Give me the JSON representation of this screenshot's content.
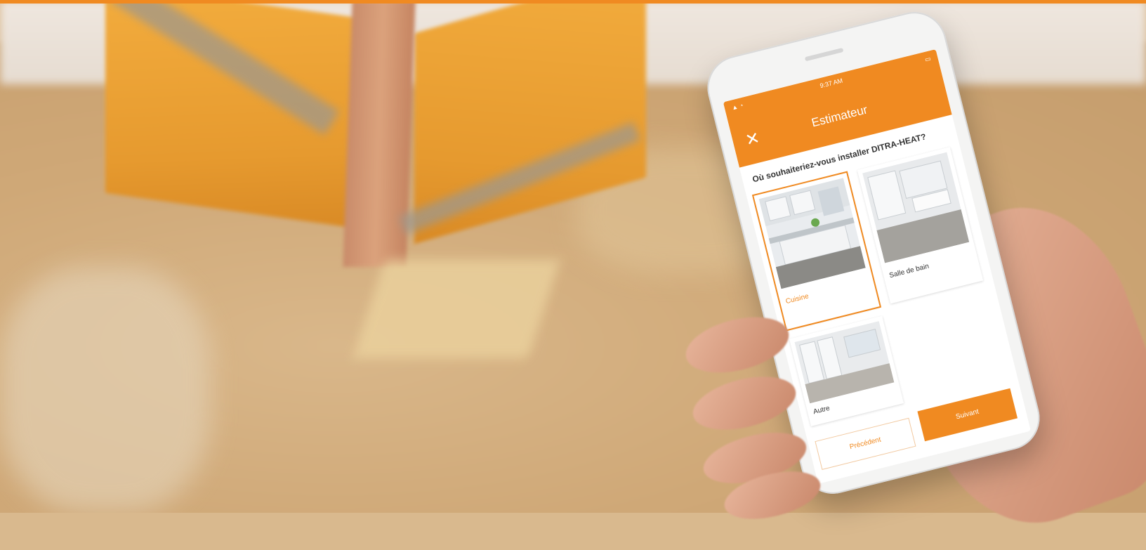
{
  "colors": {
    "accent": "#f08a21",
    "screen_bg": "#ffffff"
  },
  "phone": {
    "status_time": "9:37 AM",
    "appbar": {
      "title": "Estimateur",
      "close_icon": "close-icon"
    },
    "question": "Où souhaiteriez-vous installer DITRA-HEAT?",
    "options": [
      {
        "label": "Cuisine",
        "selected": true
      },
      {
        "label": "Salle de bain",
        "selected": false
      },
      {
        "label": "Autre",
        "selected": false
      }
    ],
    "buttons": {
      "previous": "Précédent",
      "next": "Suivant"
    }
  }
}
